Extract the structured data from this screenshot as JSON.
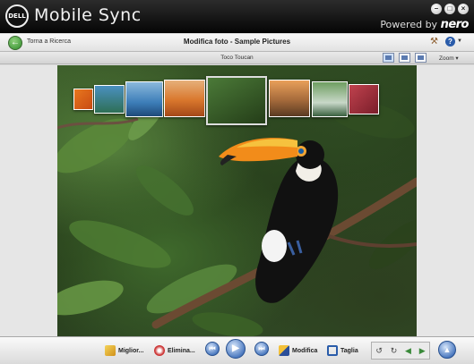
{
  "titlebar": {
    "logo": "DELL",
    "title": "Mobile Sync",
    "powered_prefix": "Powered by",
    "powered_brand": "nero",
    "buttons": [
      "minimize-icon",
      "maximize-icon",
      "close-icon"
    ]
  },
  "navbar": {
    "back_label": "Torna a Ricerca",
    "title": "Modifica foto - Sample Pictures",
    "help_label": "?"
  },
  "subbar": {
    "photo_name": "Toco Toucan",
    "zoom_label": "Zoom ▾"
  },
  "toolbar": {
    "improve_label": "Miglior...",
    "delete_label": "Elimina...",
    "edit_label": "Modifica",
    "crop_label": "Taglia"
  },
  "colors": {
    "titlebar": "#060606",
    "accent": "#4f7cc1",
    "back_button": "#2d8a2a"
  }
}
